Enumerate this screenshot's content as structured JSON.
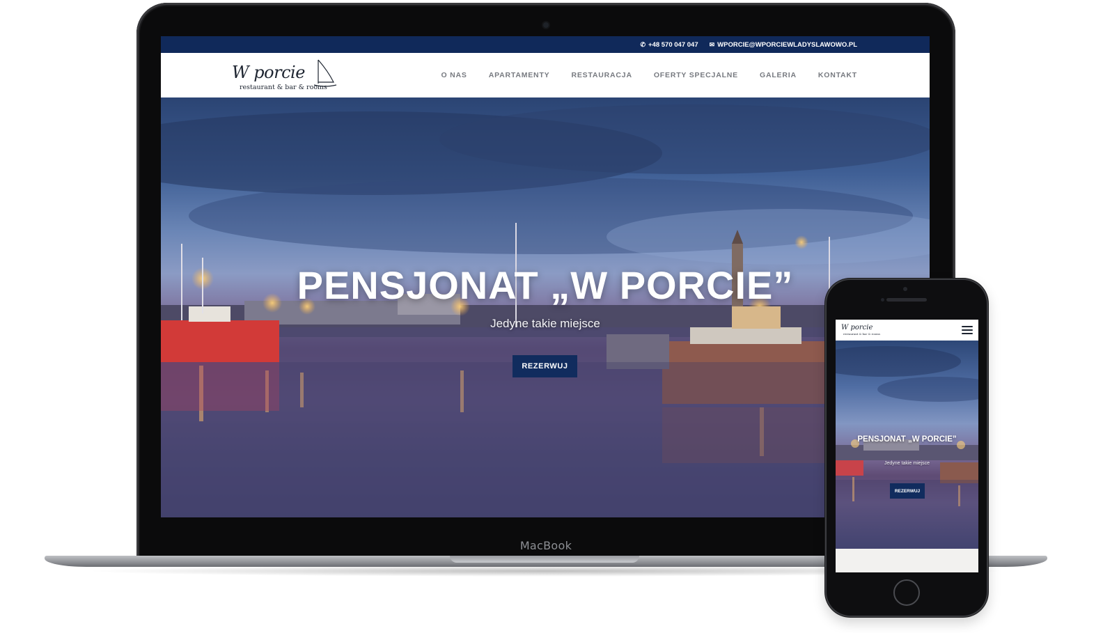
{
  "laptop": {
    "brand_label": "MacBook"
  },
  "site": {
    "topbar": {
      "phone_icon": "phone-icon",
      "phone": "+48 570 047 047",
      "email_icon": "envelope-icon",
      "email": "WPORCIE@WPORCIEWLADYSLAWOWO.PL"
    },
    "logo": {
      "script": "W porcie",
      "tagline": "restaurant & bar & rooms"
    },
    "nav": [
      {
        "label": "O NAS"
      },
      {
        "label": "APARTAMENTY"
      },
      {
        "label": "RESTAURACJA"
      },
      {
        "label": "OFERTY SPECJALNE"
      },
      {
        "label": "GALERIA"
      },
      {
        "label": "KONTAKT"
      }
    ],
    "hero": {
      "title": "PENSJONAT „W PORCIE”",
      "subtitle": "Jedyne takie miejsce",
      "button": "REZERWUJ"
    }
  },
  "mobile": {
    "logo": {
      "script": "W porcie",
      "tagline": "restaurant & bar & rooms"
    },
    "menu_icon": "hamburger-menu-icon",
    "hero": {
      "title": "PENSJONAT „W PORCIE”",
      "subtitle": "Jedyne takie miejsce",
      "button": "REZERWUJ"
    }
  },
  "colors": {
    "navy": "#10295a",
    "button": "#112c5e",
    "nav_text": "#777a80"
  }
}
